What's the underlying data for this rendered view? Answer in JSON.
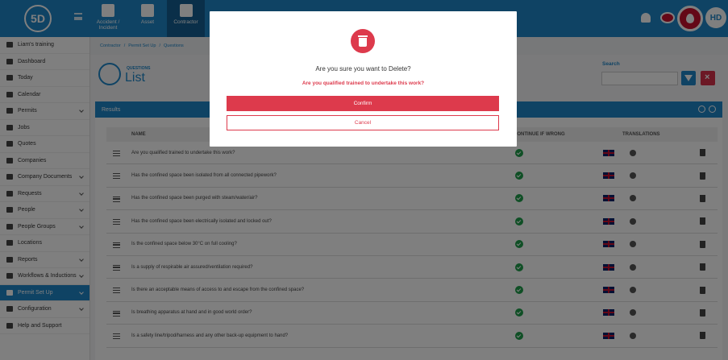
{
  "app": {
    "logo_text": "5D",
    "avatar": "HD"
  },
  "modules": [
    {
      "label": "Accident / Incident",
      "icon": "first-aid-icon"
    },
    {
      "label": "Asset",
      "icon": "asset-icon"
    },
    {
      "label": "Contractor",
      "icon": "hardhat-icon"
    }
  ],
  "sidebar": {
    "items": [
      {
        "label": "Liam's training",
        "icon": "training-icon"
      },
      {
        "label": "Dashboard",
        "icon": "dashboard-icon"
      },
      {
        "label": "Today",
        "icon": "today-icon"
      },
      {
        "label": "Calendar",
        "icon": "calendar-icon"
      },
      {
        "label": "Permits",
        "icon": "permits-icon"
      },
      {
        "label": "Jobs",
        "icon": "jobs-icon"
      },
      {
        "label": "Quotes",
        "icon": "quotes-icon"
      },
      {
        "label": "Companies",
        "icon": "companies-icon"
      },
      {
        "label": "Company Documents",
        "icon": "documents-icon"
      },
      {
        "label": "Requests",
        "icon": "requests-icon"
      },
      {
        "label": "People",
        "icon": "people-icon"
      },
      {
        "label": "People Groups",
        "icon": "groups-icon"
      },
      {
        "label": "Locations",
        "icon": "locations-icon"
      },
      {
        "label": "Reports",
        "icon": "reports-icon"
      },
      {
        "label": "Workflows & Inductions",
        "icon": "workflows-icon"
      },
      {
        "label": "Permit Set Up",
        "icon": "permit-setup-icon"
      },
      {
        "label": "Configuration",
        "icon": "configuration-icon"
      },
      {
        "label": "Help and Support",
        "icon": "help-icon"
      }
    ]
  },
  "breadcrumb": [
    "Contractor",
    "/",
    "Permit Set Up",
    "/",
    "Questions"
  ],
  "page": {
    "subtitle": "QUESTIONS",
    "title": "List"
  },
  "search": {
    "label": "Search",
    "placeholder": ""
  },
  "results": {
    "title": "Results",
    "columns": {
      "name": "NAME",
      "continue": "CONTINUE IF WRONG",
      "translations": "TRANSLATIONS"
    },
    "rows": [
      "Are you qualified trained to undertake this work?",
      "Has the confined space been isolated from all connected pipework?",
      "Has the confined space been purged with steam/water/air?",
      "Has the confined space been electrically isolated and locked out?",
      "Is the confined space below 30°C on full cooling?",
      "Is a supply of respirable air assured/ventilation required?",
      "Is there an acceptable means of access to and escape from the confined space?",
      "Is breathing apparatus at hand and in good world order?",
      "Is a safety line/tripod/harness and any other back-up equipment to hand?"
    ]
  },
  "modal": {
    "title": "Are you sure you want to Delete?",
    "question": "Are you qualified trained to undertake this work?",
    "confirm": "Confirm",
    "cancel": "Cancel"
  },
  "colors": {
    "primary": "#1f86c9",
    "danger": "#dd3a4c",
    "success": "#1e9e4a"
  }
}
